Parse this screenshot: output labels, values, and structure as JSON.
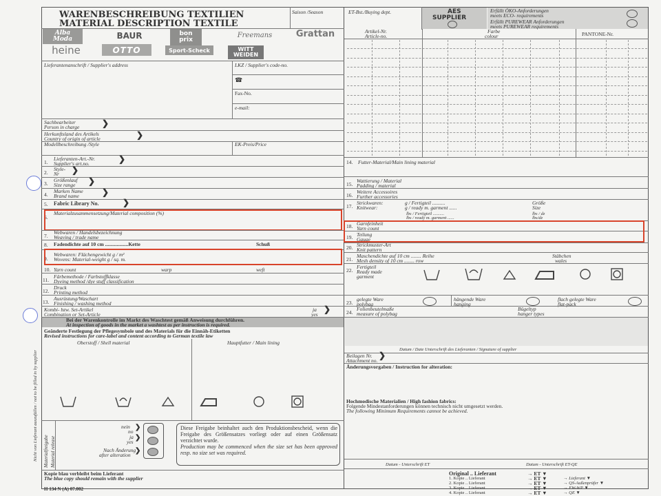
{
  "header": {
    "title_de": "WARENBESCHREIBUNG TEXTILIEN",
    "title_en": "MATERIAL DESCRIPTION TEXTILE",
    "season": "Saison /Season",
    "buying_dept": "ET-Bst./Buying dept.",
    "aes_1": "AES",
    "aes_2": "SUPPLIER",
    "oeko_1": "Erfüllt ÖKO-Anforderungen",
    "oeko_2": "meets ECO- requirements",
    "pure_1": "Erfüllt PUREWEAR Anforderungen",
    "pure_2": "meets PUREWEAR requirements"
  },
  "brands": {
    "alba_1": "Alba",
    "alba_2": "Moda",
    "baur": "BAUR",
    "bonprix_1": "bon",
    "bonprix_2": "prix",
    "freemans": "Freemans",
    "grattan": "Grattan",
    "heine": "heine",
    "otto": "OTTO",
    "sportscheck": "Sport-Scheck",
    "witt_1": "WITT",
    "witt_2": "WEIDEN"
  },
  "right_header": {
    "article_no_1": "Artikel-Nr.",
    "article_no_2": "Article-no.",
    "farbe_1": "Farbe",
    "farbe_2": "colour",
    "pantone": "PANTONE-Nr."
  },
  "left_fields": {
    "supplier_address": "Lieferantenanschrift / Supplier's address",
    "lkz": "LKZ / Supplier's code-no.",
    "phone": "☎",
    "fax": "Fax-No.",
    "email": "e-mail:",
    "sachbearbeiter_1": "Sachbearbeiter",
    "sachbearbeiter_2": "Person in charge",
    "herkunft_1": "Herkunftsland des Artikels",
    "herkunft_2": "Country of origin of article",
    "modell": "Modellbeschreibung /Style",
    "ek_preis": "EK-Preis/Price"
  },
  "numbered": {
    "f1_1": "Lieferanten-Art.-Nr.",
    "f1_2": "Supplier's art.no.",
    "f2_1": "Style-",
    "f2_2": "Nr",
    "f3_1": "Größenlauf",
    "f3_2": "Size range",
    "f4_1": "Marken Name",
    "f4_2": "Brand name",
    "f5": "Fabric Library No.",
    "f6": "Materialzusammensetzung/Material composition (%)",
    "f7_1": "Webwaren / Handelsbezeichnung",
    "f7_2": "Weaving / trade name",
    "f8_1": "Fadendichte auf 10 cm ..................Kette",
    "f8_2": "Schuß",
    "f9_1": "Webwaren: Flächengewicht g / m²",
    "f9_2": "Wovens:    Material-weight g / sq. m.",
    "f10_1": "Yarn count",
    "f10_2": "warp",
    "f10_3": "weft",
    "f11_1": "Färbemethode / Farbstoffklasse",
    "f11_2": "Dyeing method /dye stuff classification",
    "f12_1": "Druck",
    "f12_2": "Printing method",
    "f13_1": "Ausrüstung/Waschart",
    "f13_2": "Finishing / washing method",
    "kombi_1": "Kombi- bzw. Set-Artikel",
    "kombi_2": "Combination or Set-Article",
    "ja_1": "ja",
    "ja_2": "yes"
  },
  "inspection": {
    "line1": "Bei der Warenkontrolle im Markt des Waschtest gemäß Anweisung durchführen.",
    "line2": "At inspection of goods in the market a washtest as per instruction is required.",
    "g1": "Geänderte Festlegung der Pflegesymbole und des Materials für die Einnäh-Etiketten",
    "g2": "Revised instructions for care-label and content according to German textile law",
    "shell": "Oberstoff / Shell material",
    "lining": "Hauptfutter / Main lining"
  },
  "release": {
    "nein_1": "nein",
    "nein_2": "no",
    "ja_1": "ja",
    "ja_2": "yes",
    "nach_1": "Nach Änderung",
    "nach_2": "after alteration",
    "side_1": "Materialfreigabe",
    "side_2": "Material release",
    "text_de": "Diese Freigabe beinhaltet auch den Produktionsbescheid, wenn die Freigabe des Größensatzes vorliegt oder auf einen Größensatz verzichtet wurde.",
    "text_en": "Production may be commenced when the size set has been approved resp. no size set was required.",
    "vertical_note": "Nicht von Lieferant auszufüllen / not to be filled in by supplier"
  },
  "footer": {
    "blue_de": "Kopie blau verbleibt beim Lieferant",
    "blue_en": "The blue copy should remain with the supplier",
    "code": "H 134 N (A) 07.002",
    "sig_et": "Datum - Unterschrift ET",
    "sig_etqe": "Datum - Unterschrift ET-QE",
    "dist": [
      {
        "label": "Original .. Lieferant",
        "arrow": "→",
        "to": "ET"
      },
      {
        "label": "1. Kopie .. Lieferant",
        "arrow": "→",
        "to": "ET",
        "note": "Lieferant"
      },
      {
        "label": "2. Kopie .. Lieferant",
        "arrow": "→",
        "to": "ET",
        "note": "QS-Außenprüfer"
      },
      {
        "label": "3. Kopie .. Lieferant",
        "arrow": "→",
        "to": "ET",
        "note": "EW-WP"
      },
      {
        "label": "4. Kopie .. Lieferant",
        "arrow": "→",
        "to": "ET",
        "note": "QE"
      }
    ]
  },
  "right_fields": {
    "f14": "Futter-Material/Main lining material",
    "f15_1": "Wattierung / Material",
    "f15_2": "Padding / material",
    "f16_1": "Weitere Accessoires",
    "f16_2": "Further accessories",
    "f17_1": "Strickwaren:",
    "f17_2": "Knitwear:",
    "f17_3": "g / Fertigteil ..........",
    "f17_4": "g / ready m. garment ......",
    "f17_5": "lbs / Fertigteil ..........",
    "f17_6": "lbs / ready m. garment ......",
    "groesse_1": "Größe",
    "groesse_2": "Size",
    "lbs_1": "lbs / dz",
    "lbs_2": "lbs/dz",
    "f18_1": "Garnfeinheit",
    "f18_2": "Yarn count",
    "f19_1": "Teilung",
    "f19_2": "Gauge",
    "f20_1": "Strickmuster-Art",
    "f20_2": "Knit pattern",
    "f21_1": "Maschendichte auf 10 cm ........ Reihe",
    "f21_2": "Mesh density of 10 cm ........ row",
    "f21_3": "Stäbchen",
    "f21_4": "wales",
    "f22_1": "Fertigteil",
    "f22_2": "Ready made",
    "f22_3": "garment",
    "f23_1": "gelegte Ware",
    "f23_2": "polybag",
    "f23_3": "hängende Ware",
    "f23_4": "hanging",
    "f23_5": "flach gelegte Ware",
    "f23_6": "flat-pack",
    "f24_1": "Folienbeutelmaße",
    "f24_2": "measure of polybag",
    "f24_3": "Bügeltyp",
    "f24_4": "hanger types",
    "sig": "Datum / Date     Unterschrift des Lieferanten / Signature of supplier",
    "beilagen_1": "Beilagen Nr.",
    "beilagen_2": "Attachment no.",
    "aenderung": "Änderungsvorgaben / Instruction for alteration:",
    "hf_1": "Hochmodische Materialien / High fashion fabrics:",
    "hf_2": "Folgende Mindestanforderungen können technisch nicht umgesetzt werden.",
    "hf_3": "The following Minimum Requirements cannot be achieved."
  },
  "icons": {
    "care": [
      "wash-tub-icon",
      "hand-wash-icon",
      "bleach-triangle-icon",
      "iron-icon",
      "dry-clean-circle-icon",
      "tumble-dry-icon"
    ]
  },
  "colors": {
    "highlight": "#d8432a",
    "punch_hole": "#6a7bd8",
    "line": "#555555"
  }
}
